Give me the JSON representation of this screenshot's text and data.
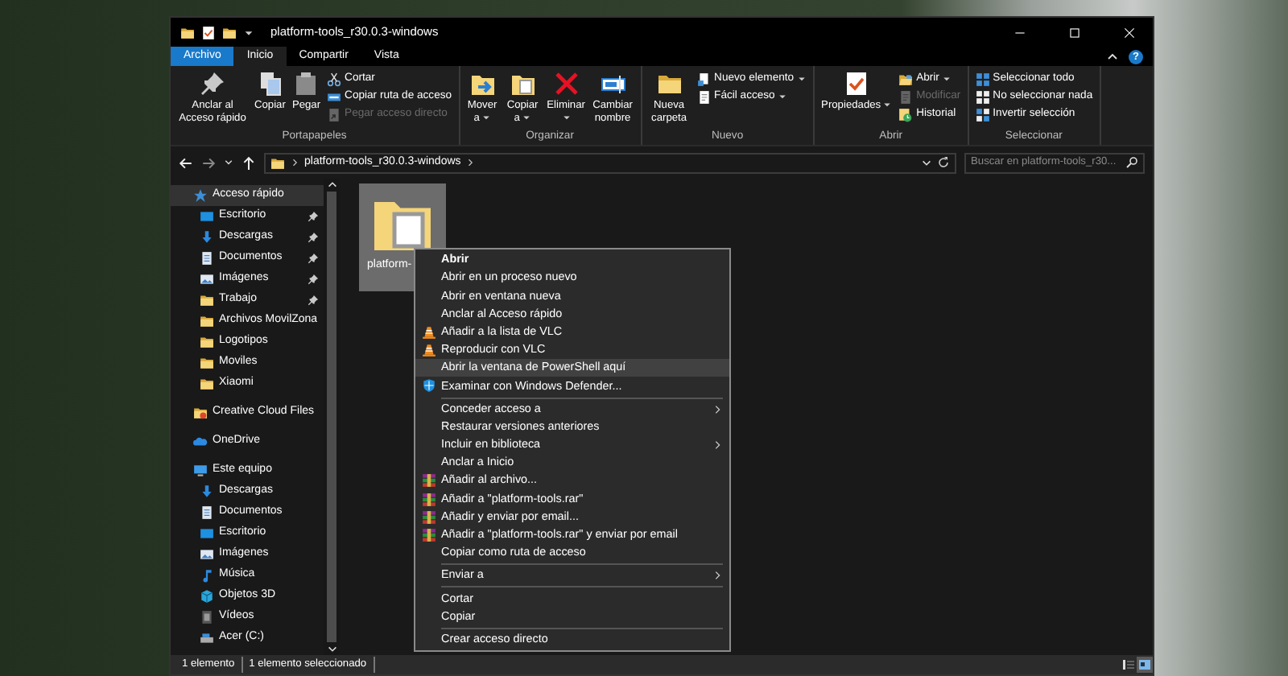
{
  "window": {
    "title": "platform-tools_r30.0.3-windows"
  },
  "ribbon": {
    "tabs": [
      {
        "label": "Archivo",
        "kind": "file",
        "selected": false
      },
      {
        "label": "Inicio",
        "kind": "tab",
        "selected": true
      },
      {
        "label": "Compartir",
        "kind": "tab",
        "selected": false
      },
      {
        "label": "Vista",
        "kind": "tab",
        "selected": false
      }
    ],
    "help": "?",
    "groups": [
      {
        "label": "Portapapeles",
        "items": [
          {
            "label": "Anclar al Acceso rápido",
            "kind": "large",
            "dropdown": false,
            "disabled": false
          },
          {
            "label": "Copiar",
            "kind": "large",
            "dropdown": false,
            "disabled": false
          },
          {
            "label": "Pegar",
            "kind": "large",
            "dropdown": false,
            "disabled": false
          },
          {
            "label": "Cortar",
            "kind": "small",
            "dropdown": false,
            "disabled": false
          },
          {
            "label": "Copiar ruta de acceso",
            "kind": "small",
            "dropdown": false,
            "disabled": false
          },
          {
            "label": "Pegar acceso directo",
            "kind": "small",
            "dropdown": false,
            "disabled": true
          }
        ]
      },
      {
        "label": "Organizar",
        "items": [
          {
            "label": "Mover a",
            "kind": "large",
            "dropdown": true,
            "disabled": false
          },
          {
            "label": "Copiar a",
            "kind": "large",
            "dropdown": true,
            "disabled": false
          },
          {
            "label": "Eliminar",
            "kind": "large",
            "dropdown": true,
            "disabled": false
          },
          {
            "label": "Cambiar nombre",
            "kind": "large",
            "dropdown": false,
            "disabled": false
          }
        ]
      },
      {
        "label": "Nuevo",
        "items": [
          {
            "label": "Nueva carpeta",
            "kind": "large",
            "dropdown": false,
            "disabled": false
          },
          {
            "label": "Nuevo elemento",
            "kind": "small",
            "dropdown": true,
            "disabled": false
          },
          {
            "label": "Fácil acceso",
            "kind": "small",
            "dropdown": true,
            "disabled": false
          }
        ]
      },
      {
        "label": "Abrir",
        "items": [
          {
            "label": "Propiedades",
            "kind": "large",
            "dropdown": true,
            "disabled": false
          },
          {
            "label": "Abrir",
            "kind": "small",
            "dropdown": true,
            "disabled": false
          },
          {
            "label": "Modificar",
            "kind": "small",
            "dropdown": false,
            "disabled": true
          },
          {
            "label": "Historial",
            "kind": "small",
            "dropdown": false,
            "disabled": false
          }
        ]
      },
      {
        "label": "Seleccionar",
        "items": [
          {
            "label": "Seleccionar todo",
            "kind": "small",
            "dropdown": false,
            "disabled": false
          },
          {
            "label": "No seleccionar nada",
            "kind": "small",
            "dropdown": false,
            "disabled": false
          },
          {
            "label": "Invertir selección",
            "kind": "small",
            "dropdown": false,
            "disabled": false
          }
        ]
      }
    ]
  },
  "address_bar": {
    "path": [
      "platform-tools_r30.0.3-windows"
    ]
  },
  "search": {
    "placeholder": "Buscar en platform-tools_r30..."
  },
  "navigation": [
    {
      "label": "Acceso rápido",
      "selected": true,
      "children": [
        {
          "label": "Escritorio",
          "pinned": true,
          "selected": false
        },
        {
          "label": "Descargas",
          "pinned": true,
          "selected": false
        },
        {
          "label": "Documentos",
          "pinned": true,
          "selected": false
        },
        {
          "label": "Imágenes",
          "pinned": true,
          "selected": false
        },
        {
          "label": "Trabajo",
          "pinned": true,
          "selected": false
        },
        {
          "label": "Archivos MovilZona",
          "pinned": false,
          "selected": false
        },
        {
          "label": "Logotipos",
          "pinned": false,
          "selected": false
        },
        {
          "label": "Moviles",
          "pinned": false,
          "selected": false
        },
        {
          "label": "Xiaomi",
          "pinned": false,
          "selected": false
        }
      ]
    },
    {
      "label": "Creative Cloud Files",
      "selected": false
    },
    {
      "label": "OneDrive",
      "selected": false
    },
    {
      "label": "Este equipo",
      "selected": false,
      "children": [
        {
          "label": "Descargas",
          "selected": false
        },
        {
          "label": "Documentos",
          "selected": false
        },
        {
          "label": "Escritorio",
          "selected": false
        },
        {
          "label": "Imágenes",
          "selected": false
        },
        {
          "label": "Música",
          "selected": false
        },
        {
          "label": "Objetos 3D",
          "selected": false
        },
        {
          "label": "Vídeos",
          "selected": false
        },
        {
          "label": "Acer (C:)",
          "selected": false
        }
      ]
    }
  ],
  "files": [
    {
      "label": "platform-",
      "selected": true
    }
  ],
  "context_menu": [
    {
      "kind": "item",
      "label": "Abrir",
      "default": true,
      "submenu": false,
      "selected": false
    },
    {
      "kind": "item",
      "label": "Abrir en un proceso nuevo",
      "default": false,
      "submenu": false,
      "selected": false
    },
    {
      "kind": "item",
      "label": "Abrir en ventana nueva",
      "default": false,
      "submenu": false,
      "selected": false
    },
    {
      "kind": "item",
      "label": "Anclar al Acceso rápido",
      "default": false,
      "submenu": false,
      "selected": false
    },
    {
      "kind": "item",
      "label": "Añadir a la lista de VLC",
      "default": false,
      "submenu": false,
      "selected": false
    },
    {
      "kind": "item",
      "label": "Reproducir con VLC",
      "default": false,
      "submenu": false,
      "selected": false
    },
    {
      "kind": "item",
      "label": "Abrir la ventana de PowerShell aquí",
      "default": false,
      "submenu": false,
      "selected": true
    },
    {
      "kind": "item",
      "label": "Examinar con Windows Defender...",
      "default": false,
      "submenu": false,
      "selected": false
    },
    {
      "kind": "separator"
    },
    {
      "kind": "item",
      "label": "Conceder acceso a",
      "default": false,
      "submenu": true,
      "selected": false
    },
    {
      "kind": "item",
      "label": "Restaurar versiones anteriores",
      "default": false,
      "submenu": false,
      "selected": false
    },
    {
      "kind": "item",
      "label": "Incluir en biblioteca",
      "default": false,
      "submenu": true,
      "selected": false
    },
    {
      "kind": "item",
      "label": "Anclar a Inicio",
      "default": false,
      "submenu": false,
      "selected": false
    },
    {
      "kind": "item",
      "label": "Añadir al archivo...",
      "default": false,
      "submenu": false,
      "selected": false
    },
    {
      "kind": "item",
      "label": "Añadir a \"platform-tools.rar\"",
      "default": false,
      "submenu": false,
      "selected": false
    },
    {
      "kind": "item",
      "label": "Añadir y enviar por email...",
      "default": false,
      "submenu": false,
      "selected": false
    },
    {
      "kind": "item",
      "label": "Añadir a \"platform-tools.rar\" y enviar por email",
      "default": false,
      "submenu": false,
      "selected": false
    },
    {
      "kind": "item",
      "label": "Copiar como ruta de acceso",
      "default": false,
      "submenu": false,
      "selected": false
    },
    {
      "kind": "separator"
    },
    {
      "kind": "item",
      "label": "Enviar a",
      "default": false,
      "submenu": true,
      "selected": false
    },
    {
      "kind": "separator"
    },
    {
      "kind": "item",
      "label": "Cortar",
      "default": false,
      "submenu": false,
      "selected": false
    },
    {
      "kind": "item",
      "label": "Copiar",
      "default": false,
      "submenu": false,
      "selected": false
    },
    {
      "kind": "separator"
    },
    {
      "kind": "item",
      "label": "Crear acceso directo",
      "default": false,
      "submenu": false,
      "selected": false
    }
  ],
  "status_bar": {
    "texts": [
      "1 elemento",
      "1 elemento seleccionado"
    ],
    "views": [
      {
        "kind": "details",
        "selected": false
      },
      {
        "kind": "large_icons",
        "selected": true
      }
    ]
  }
}
